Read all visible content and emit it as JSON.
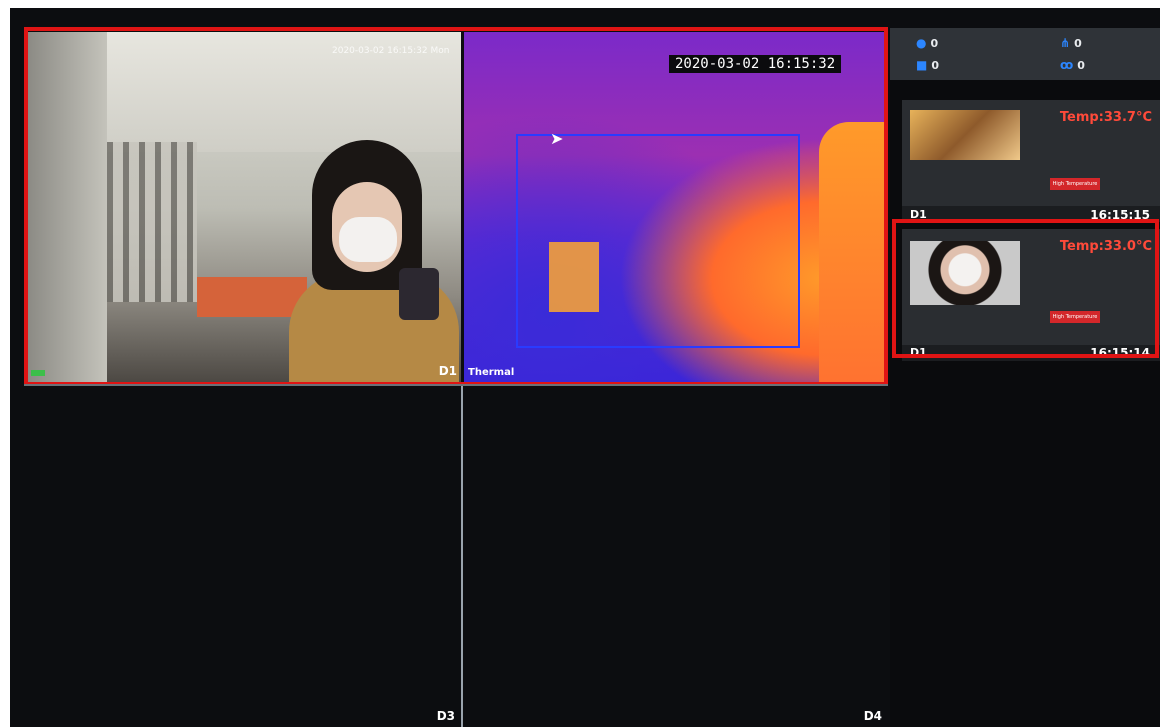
{
  "cameras": {
    "d1": {
      "label": "D1",
      "osd_time": "2020-03-02 16:15:32 Mon"
    },
    "thermal": {
      "label": "Thermal",
      "osd_time": "2020-03-02 16:15:32"
    },
    "d3": {
      "label": "D3"
    },
    "d4": {
      "label": "D4"
    }
  },
  "stats": {
    "person_count": "0",
    "car_count": "0",
    "pedestrian_count": "0",
    "bike_count": "0"
  },
  "alerts": [
    {
      "temp": "Temp:33.7°C",
      "tag": "High Temperature",
      "channel": "D1",
      "time": "16:15:15"
    },
    {
      "temp": "Temp:33.0°C",
      "tag": "High Temperature",
      "channel": "D1",
      "time": "16:15:14"
    }
  ],
  "colors": {
    "alert_red": "#e01414",
    "temp_text": "#ff4a3a",
    "icon_blue": "#2c86ff"
  },
  "icons": {
    "person": "person-icon",
    "car": "car-icon",
    "pedestrian": "pedestrian-icon",
    "bike": "bike-icon"
  }
}
